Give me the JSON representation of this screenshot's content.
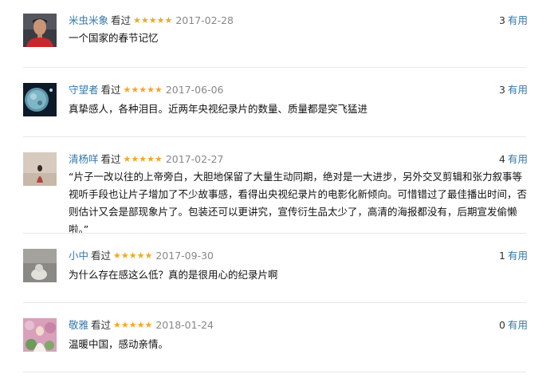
{
  "verb": "看过",
  "stars_glyph": "★★★★★",
  "star_color": "#f5a623",
  "link_color": "#3377aa",
  "useful_label": "有用",
  "reviews": [
    {
      "user": "米虫米象",
      "rating": 5,
      "date": "2017-02-28",
      "useful_count": "3",
      "content": "一个国家的春节记忆"
    },
    {
      "user": "守望者",
      "rating": 5,
      "date": "2017-06-06",
      "useful_count": "3",
      "content": "真挚感人，各种泪目。近两年央视纪录片的数量、质量都是突飞猛进"
    },
    {
      "user": "清杨咩",
      "rating": 5,
      "date": "2017-02-27",
      "useful_count": "4",
      "content": "“片子一改以往的上帝旁白，大胆地保留了大量生动同期，绝对是一大进步，另外交叉剪辑和张力叙事等视听手段也让片子增加了不少故事感，看得出央视纪录片的电影化新倾向。可惜错过了最佳播出时间，否则估计又会是部现象片了。包装还可以更讲究，宣传衍生品太少了，高清的海报都没有，后期宣发偷懒啦。”"
    },
    {
      "user": "小中",
      "rating": 5,
      "date": "2017-09-30",
      "useful_count": "1",
      "content": "为什么存在感这么低？真的是很用心的纪录片啊"
    },
    {
      "user": "敬雅",
      "rating": 5,
      "date": "2018-01-24",
      "useful_count": "0",
      "content": "温暖中国，感动亲情。"
    }
  ]
}
